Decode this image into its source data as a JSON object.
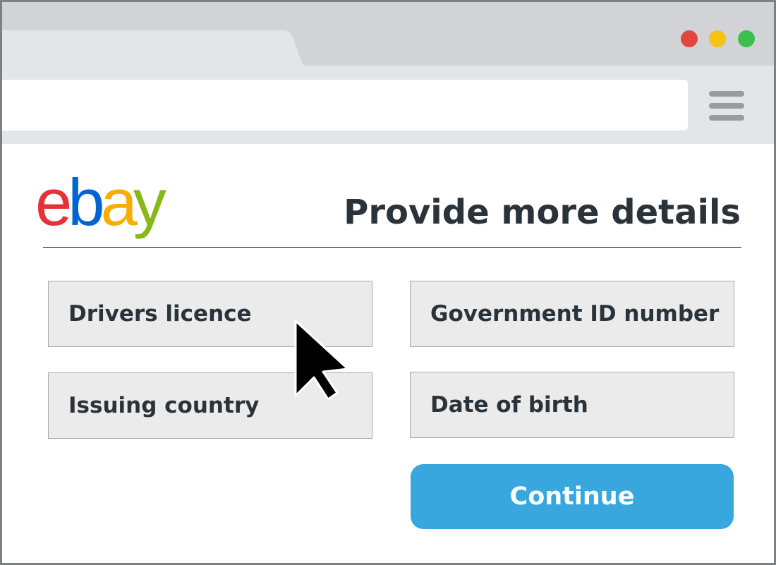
{
  "browser": {
    "window_controls": [
      {
        "name": "close",
        "color": "#e2473e"
      },
      {
        "name": "minimize",
        "color": "#f5c318"
      },
      {
        "name": "maximize",
        "color": "#3cbf4c"
      }
    ],
    "menu_icon": "hamburger-menu-icon"
  },
  "brand": {
    "logo_letters": [
      "e",
      "b",
      "a",
      "y"
    ],
    "logo_colors": [
      "#e53238",
      "#0064d2",
      "#f5af02",
      "#86b817"
    ]
  },
  "page": {
    "title": "Provide more details"
  },
  "form": {
    "fields": {
      "drivers_licence": "Drivers licence",
      "government_id": "Government ID number",
      "issuing_country": "Issuing country",
      "date_of_birth": "Date of birth"
    },
    "continue_label": "Continue",
    "accent_color": "#38a7dd"
  },
  "pointer": {
    "icon": "arrow-cursor-icon"
  }
}
